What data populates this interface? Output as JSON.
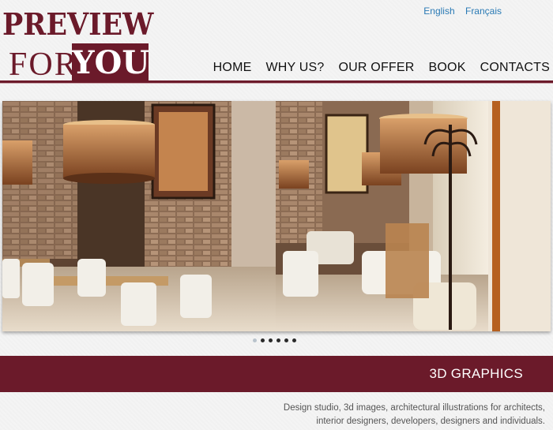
{
  "language": {
    "english": "English",
    "french": "Français"
  },
  "logo": {
    "line1": "PREVIEW",
    "for": "FOR",
    "you": "YOU"
  },
  "nav": {
    "items": [
      "HOME",
      "WHY US?",
      "OUR OFFER",
      "BOOK",
      "CONTACTS"
    ]
  },
  "slider": {
    "dot_count": 6,
    "active_dot": 1
  },
  "band": {
    "title": "3D GRAPHICS"
  },
  "description": {
    "line1": "Design studio, 3d images, architectural illustrations for architects,",
    "line2": "interior designers, developers, designers and individuals."
  },
  "colors": {
    "brand": "#6b1a2a",
    "link": "#2a7ab5"
  }
}
